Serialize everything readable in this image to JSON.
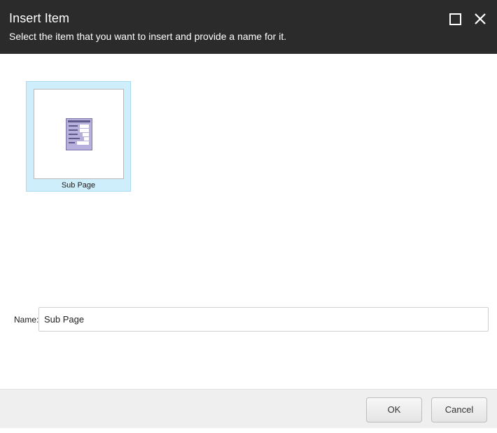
{
  "dialog": {
    "title": "Insert Item",
    "subtitle": "Select the item that you want to insert and provide a name for it.",
    "window_controls": [
      "maximize-icon",
      "close-icon"
    ]
  },
  "items": [
    {
      "label": "Sub Page",
      "icon": "page-template-icon",
      "selected": true
    }
  ],
  "name_field": {
    "label": "Name:",
    "value": "Sub Page"
  },
  "footer": {
    "ok_label": "OK",
    "cancel_label": "Cancel"
  },
  "colors": {
    "titlebar": "#2b2b2b",
    "selection": "#cfeefc",
    "footer": "#efefef"
  }
}
